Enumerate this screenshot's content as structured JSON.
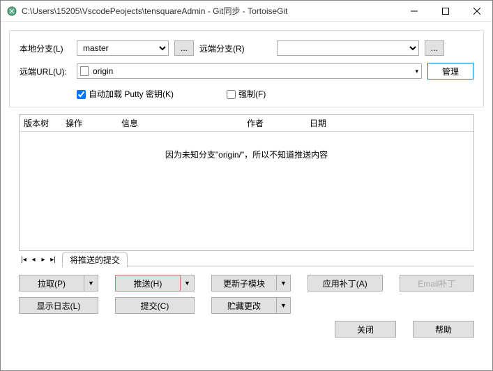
{
  "window": {
    "title": "C:\\Users\\15205\\VscodePeojects\\tensquareAdmin - Git同步 - TortoiseGit"
  },
  "form": {
    "local_branch_label": "本地分支(L)",
    "local_branch_value": "master",
    "remote_branch_label": "远端分支(R)",
    "remote_branch_value": "",
    "remote_url_label": "远端URL(U):",
    "remote_url_value": "origin",
    "manage_label": "管理",
    "autoload_label": "自动加载 Putty 密钥(K)",
    "force_label": "强制(F)"
  },
  "table": {
    "headers": {
      "tree": "版本树",
      "op": "操作",
      "info": "信息",
      "author": "作者",
      "date": "日期"
    },
    "empty_msg": "因为未知分支\"origin/\"，所以不知道推送内容"
  },
  "tab": {
    "label": "将推送的提交"
  },
  "buttons": {
    "pull": "拉取(P)",
    "push": "推送(H)",
    "submodule": "更新子模块",
    "apply_patch": "应用补丁(A)",
    "email_patch": "Email补丁",
    "log": "显示日志(L)",
    "commit": "提交(C)",
    "stash": "贮藏更改",
    "close": "关闭",
    "help": "帮助",
    "dots": "...",
    "dropdown": "▼"
  }
}
